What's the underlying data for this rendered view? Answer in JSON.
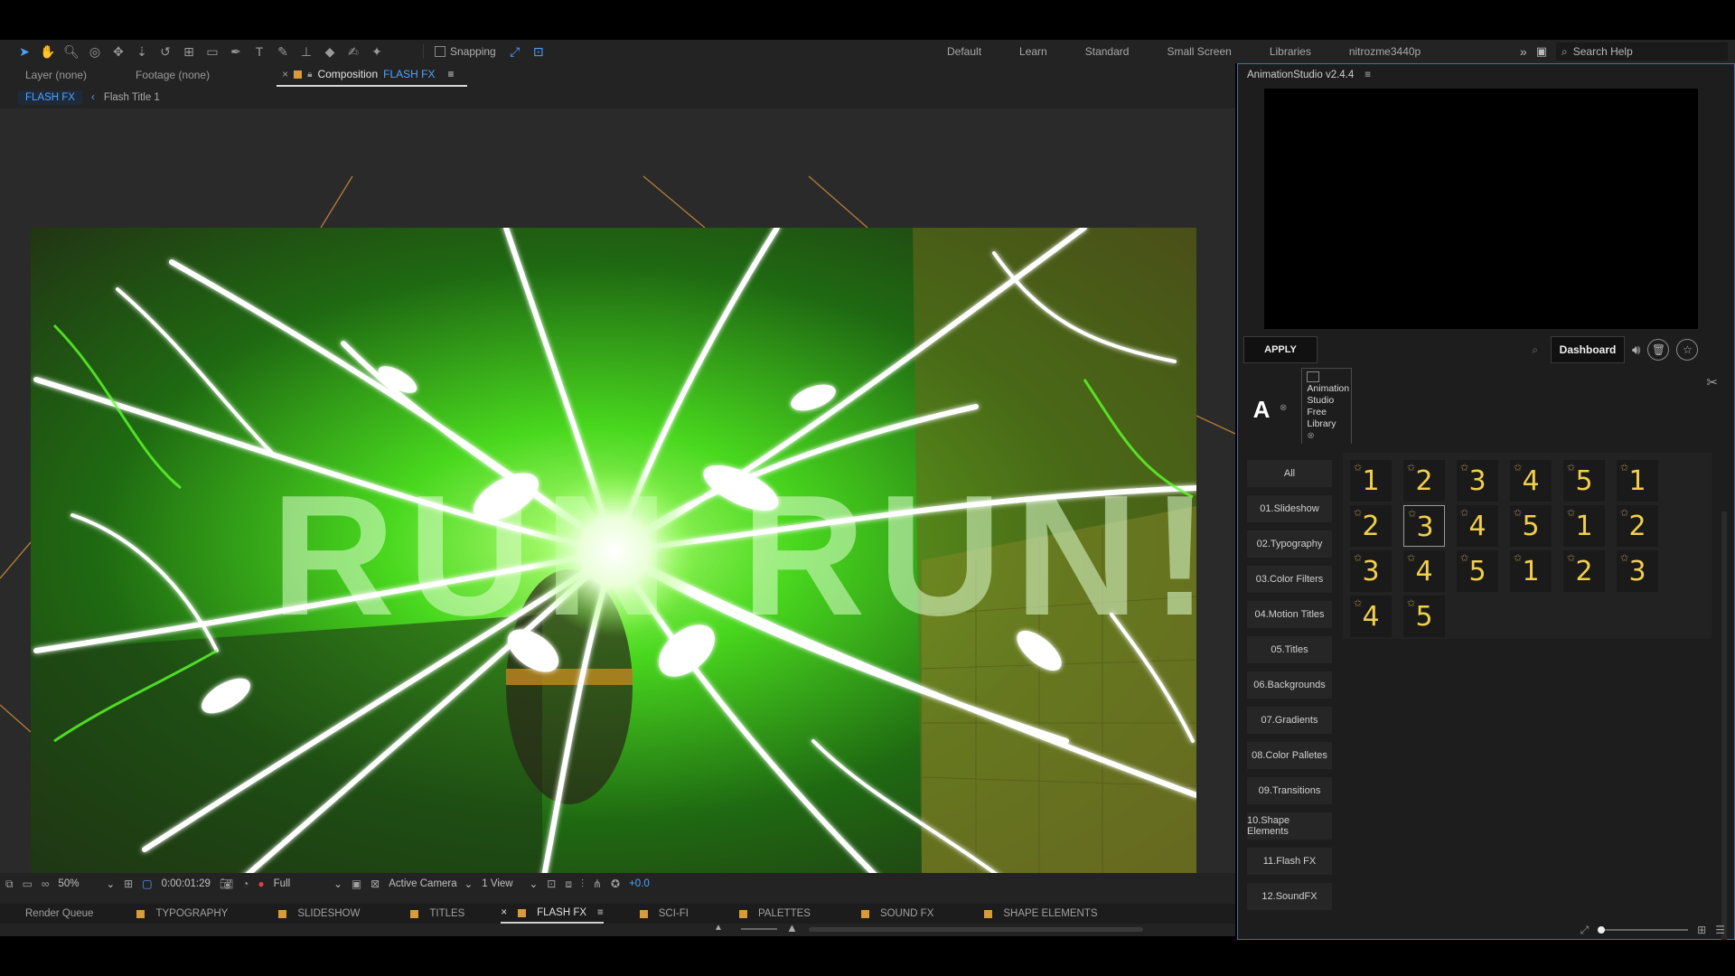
{
  "toolbar": {
    "snapping_label": "Snapping",
    "workspaces": [
      "Default",
      "Learn",
      "Standard",
      "Small Screen",
      "Libraries",
      "nitrozme3440p"
    ],
    "search_help": "Search Help"
  },
  "comp_panel": {
    "tabs": {
      "layer": "Layer (none)",
      "footage": "Footage (none)",
      "composition_prefix": "Composition",
      "composition_name": "FLASH FX"
    },
    "breadcrumb": {
      "active": "FLASH FX",
      "child": "Flash Title 1"
    },
    "viewer_text": "RUN RUN!",
    "footer": {
      "zoom": "50%",
      "timecode": "0:00:01:29",
      "resolution": "Full",
      "camera": "Active Camera",
      "view": "1 View",
      "exposure": "+0.0"
    }
  },
  "timeline_tabs": [
    "Render Queue",
    "TYPOGRAPHY",
    "SLIDESHOW",
    "TITLES",
    "FLASH FX",
    "SCI-FI",
    "PALETTES",
    "SOUND FX",
    "SHAPE ELEMENTS"
  ],
  "animation_studio": {
    "title": "AnimationStudio v2.4.4",
    "apply_label": "APPLY",
    "dashboard_label": "Dashboard",
    "library_card": "Animation Studio Free Library",
    "categories": [
      "All",
      "01.Slideshow",
      "02.Typography",
      "03.Color Filters",
      "04.Motion Titles",
      "05.Titles",
      "06.Backgrounds",
      "07.Gradients",
      "08.Color Palletes",
      "09.Transitions",
      "10.Shape Elements",
      "11.Flash FX",
      "12.SoundFX"
    ],
    "tiles": [
      "1",
      "2",
      "3",
      "4",
      "5",
      "1",
      "2",
      "3",
      "4",
      "5",
      "1",
      "2",
      "3",
      "4",
      "5",
      "1",
      "2",
      "3",
      "4",
      "5"
    ],
    "selected_tile_index": 7
  },
  "colors": {
    "accent_blue": "#4da3ff",
    "tile_yellow": "#f2cf4a",
    "panel_border": "#3d6fa8",
    "flash_green": "#7dff3a"
  }
}
